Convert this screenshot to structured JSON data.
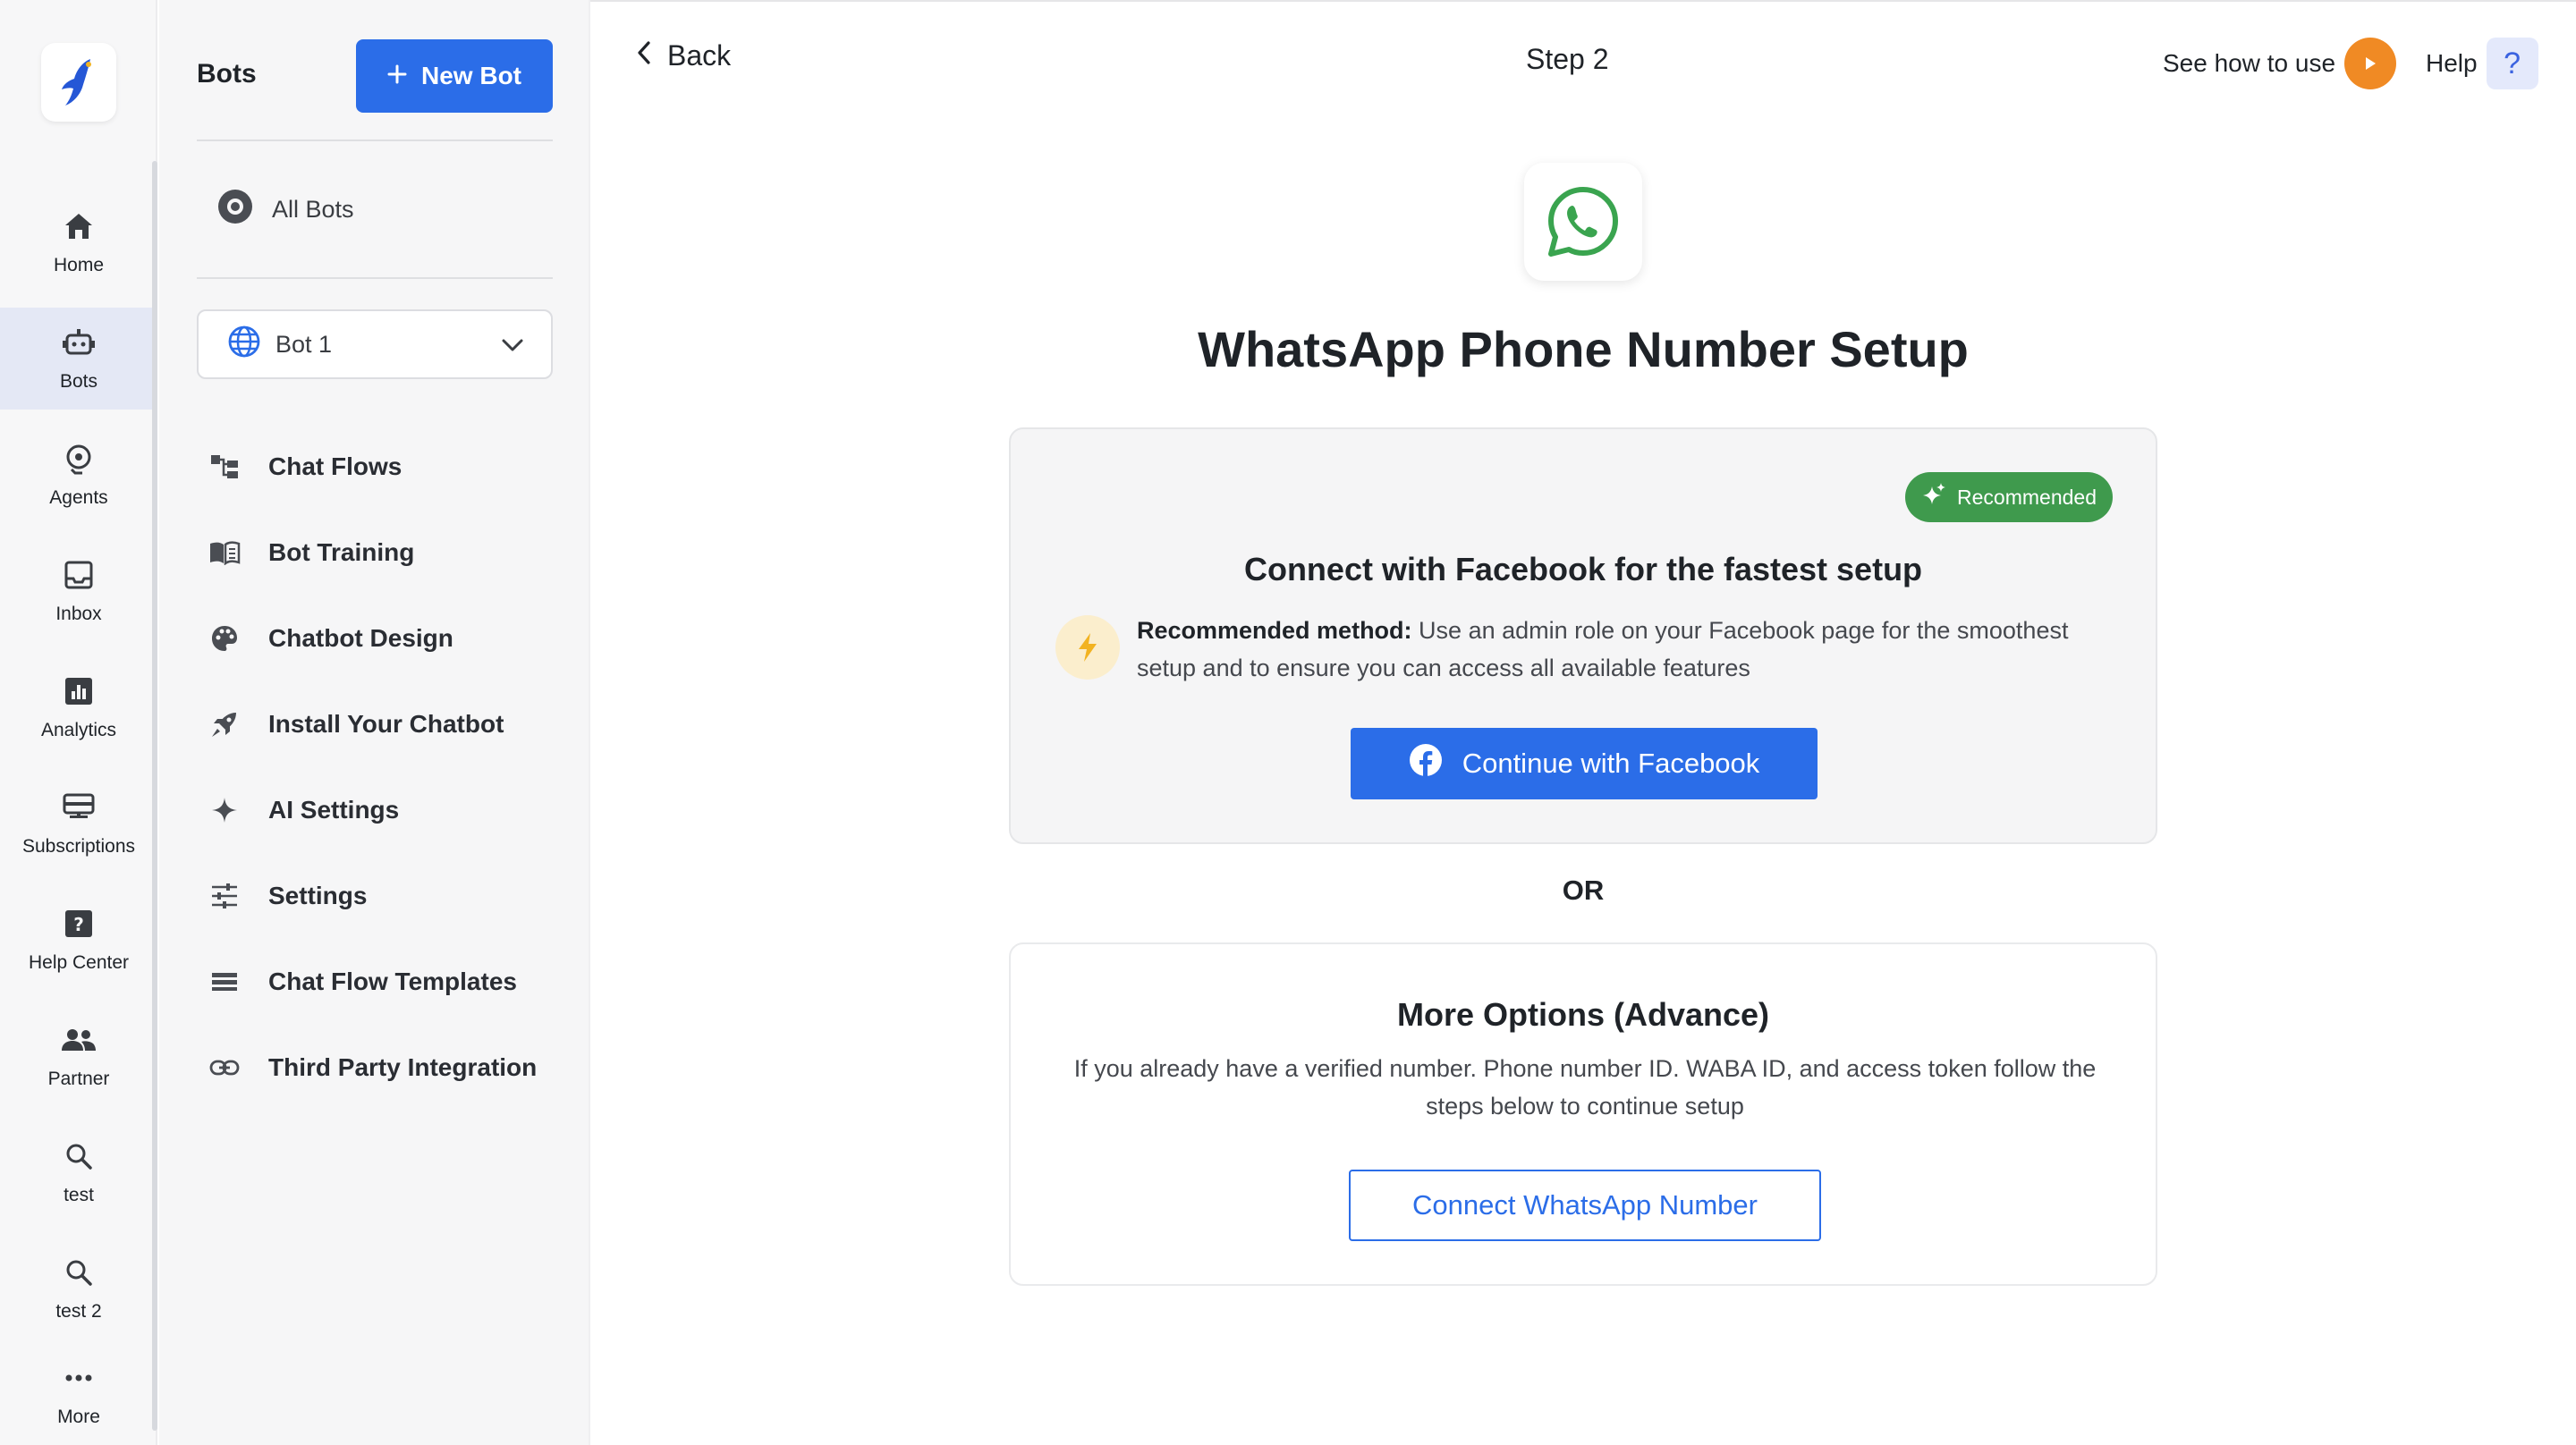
{
  "rail": {
    "items": [
      {
        "label": "Home",
        "icon": "home-icon"
      },
      {
        "label": "Bots",
        "icon": "bot-icon",
        "active": true
      },
      {
        "label": "Agents",
        "icon": "agent-icon"
      },
      {
        "label": "Inbox",
        "icon": "inbox-icon"
      },
      {
        "label": "Analytics",
        "icon": "analytics-icon"
      },
      {
        "label": "Subscriptions",
        "icon": "subscriptions-icon"
      },
      {
        "label": "Help Center",
        "icon": "help-center-icon"
      },
      {
        "label": "Partner",
        "icon": "partner-icon"
      },
      {
        "label": "test",
        "icon": "search-icon"
      },
      {
        "label": "test 2",
        "icon": "search-icon"
      },
      {
        "label": "More",
        "icon": "more-icon"
      }
    ]
  },
  "sidebar": {
    "title": "Bots",
    "new_bot_label": "New Bot",
    "all_bots_label": "All Bots",
    "bot_select_value": "Bot 1",
    "menu": [
      {
        "label": "Chat Flows",
        "icon": "chat-flows-icon"
      },
      {
        "label": "Bot Training",
        "icon": "book-icon"
      },
      {
        "label": "Chatbot Design",
        "icon": "palette-icon"
      },
      {
        "label": "Install Your Chatbot",
        "icon": "rocket-icon"
      },
      {
        "label": "AI Settings",
        "icon": "sparkle-icon"
      },
      {
        "label": "Settings",
        "icon": "sliders-icon"
      },
      {
        "label": "Chat Flow Templates",
        "icon": "templates-icon"
      },
      {
        "label": "Third Party Integration",
        "icon": "link-icon"
      }
    ]
  },
  "header": {
    "back_label": "Back",
    "step_label": "Step 2",
    "see_how_label": "See how to use",
    "help_label": "Help",
    "help_glyph": "?"
  },
  "main": {
    "title": "WhatsApp Phone Number Setup",
    "facebook_card": {
      "badge": "Recommended",
      "title": "Connect with Facebook for the fastest setup",
      "method_bold": "Recommended method:",
      "method_text": " Use an admin role on your Facebook page for the smoothest setup and to ensure you can access all available features",
      "button_label": "Continue with Facebook"
    },
    "or_label": "OR",
    "advanced_card": {
      "title": "More Options (Advance)",
      "text": "If you already have a verified number. Phone number ID. WABA ID, and access token follow the steps below to continue setup",
      "button_label": "Connect WhatsApp Number"
    }
  },
  "colors": {
    "accent": "#2b6de8",
    "recommended_green": "#3f9a4d",
    "whatsapp_green": "#3aa44f",
    "play_orange": "#f08a24",
    "brand_blue": "#2557d6"
  }
}
